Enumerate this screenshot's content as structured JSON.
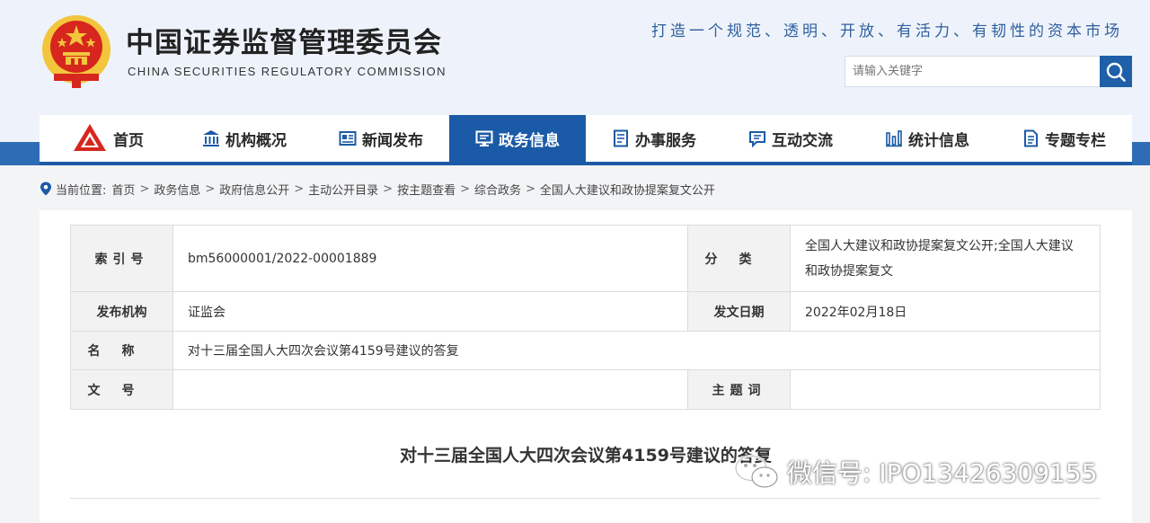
{
  "header": {
    "site_title": "中国证券监督管理委员会",
    "site_subtitle": "CHINA SECURITIES REGULATORY COMMISSION",
    "slogan": "打造一个规范、透明、开放、有活力、有韧性的资本市场",
    "search_placeholder": "请输入关键字"
  },
  "nav": {
    "items": [
      {
        "label": "首页",
        "icon": "csrc-logo-icon"
      },
      {
        "label": "机构概况",
        "icon": "building-icon"
      },
      {
        "label": "新闻发布",
        "icon": "newspaper-icon"
      },
      {
        "label": "政务信息",
        "icon": "monitor-icon",
        "active": true
      },
      {
        "label": "办事服务",
        "icon": "document-list-icon"
      },
      {
        "label": "互动交流",
        "icon": "chat-icon"
      },
      {
        "label": "统计信息",
        "icon": "bar-chart-icon"
      },
      {
        "label": "专题专栏",
        "icon": "file-icon"
      }
    ]
  },
  "breadcrumb": {
    "prefix": "当前位置:",
    "items": [
      "首页",
      "政务信息",
      "政府信息公开",
      "主动公开目录",
      "按主题查看",
      "综合政务",
      "全国人大建议和政协提案复文公开"
    ]
  },
  "meta": {
    "index_label": "索引号",
    "index_value": "bm56000001/2022-00001889",
    "category_label": "分类",
    "category_value": "全国人大建议和政协提案复文公开;全国人大建议和政协提案复文",
    "publisher_label": "发布机构",
    "publisher_value": "证监会",
    "date_label": "发文日期",
    "date_value": "2022年02月18日",
    "name_label": "名称",
    "name_value": "对十三届全国人大四次会议第4159号建议的答复",
    "doc_no_label": "文号",
    "doc_no_value": "",
    "keyword_label": "主题词",
    "keyword_value": ""
  },
  "document": {
    "title": "对十三届全国人大四次会议第4159号建议的答复"
  },
  "watermark": {
    "text": "微信号: IPO13426309155"
  },
  "colors": {
    "brand_blue": "#1b5aa6",
    "slogan_blue": "#2f5f9e",
    "emblem_red": "#d7261e",
    "emblem_gold": "#f2c53d"
  }
}
